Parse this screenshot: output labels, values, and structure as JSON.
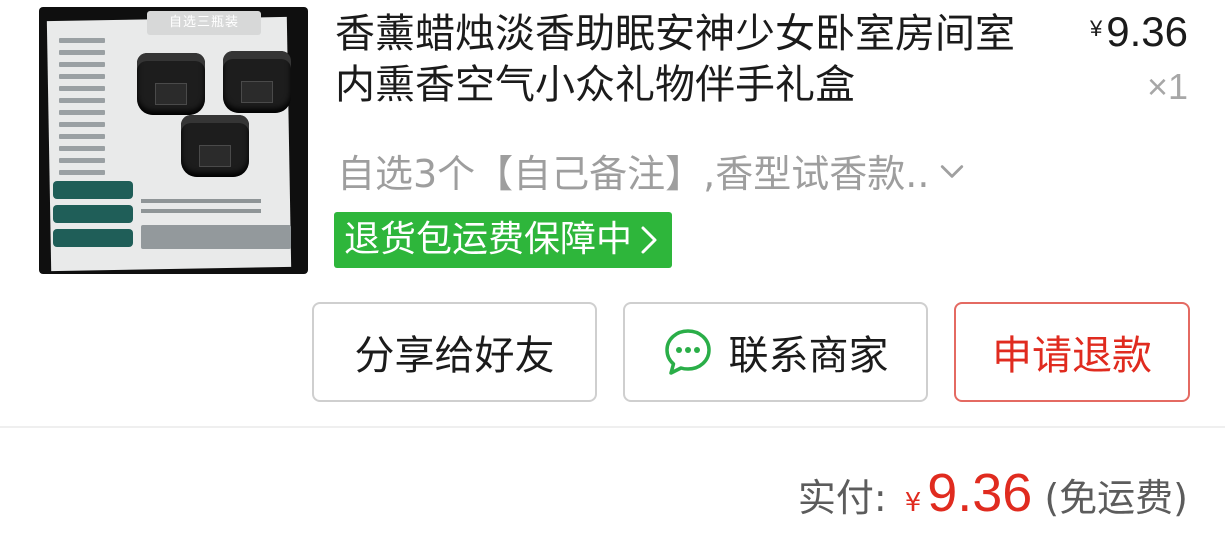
{
  "product": {
    "image_banner": "自选三瓶装",
    "title": "香薰蜡烛淡香助眠安神少女卧室房间室内熏香空气小众礼物伴手礼盒",
    "price_symbol": "¥",
    "price": "9.36",
    "quantity": "×1",
    "spec": "自选3个【自己备注】,香型试香款..",
    "guarantee": "退货包运费保障中",
    "icons": {
      "spec_expand": "chevron-down-icon",
      "guarantee_arrow": "chevron-right-icon",
      "contact": "chat-bubble-icon"
    }
  },
  "actions": {
    "share": "分享给好友",
    "contact": "联系商家",
    "refund": "申请退款"
  },
  "summary": {
    "label": "实付:",
    "currency": "¥",
    "amount": "9.36",
    "shipping_note": "(免运费)"
  },
  "colors": {
    "accent_red": "#e02b1f",
    "guarantee_green": "#2eb63b",
    "chat_icon_green": "#2aae48"
  }
}
